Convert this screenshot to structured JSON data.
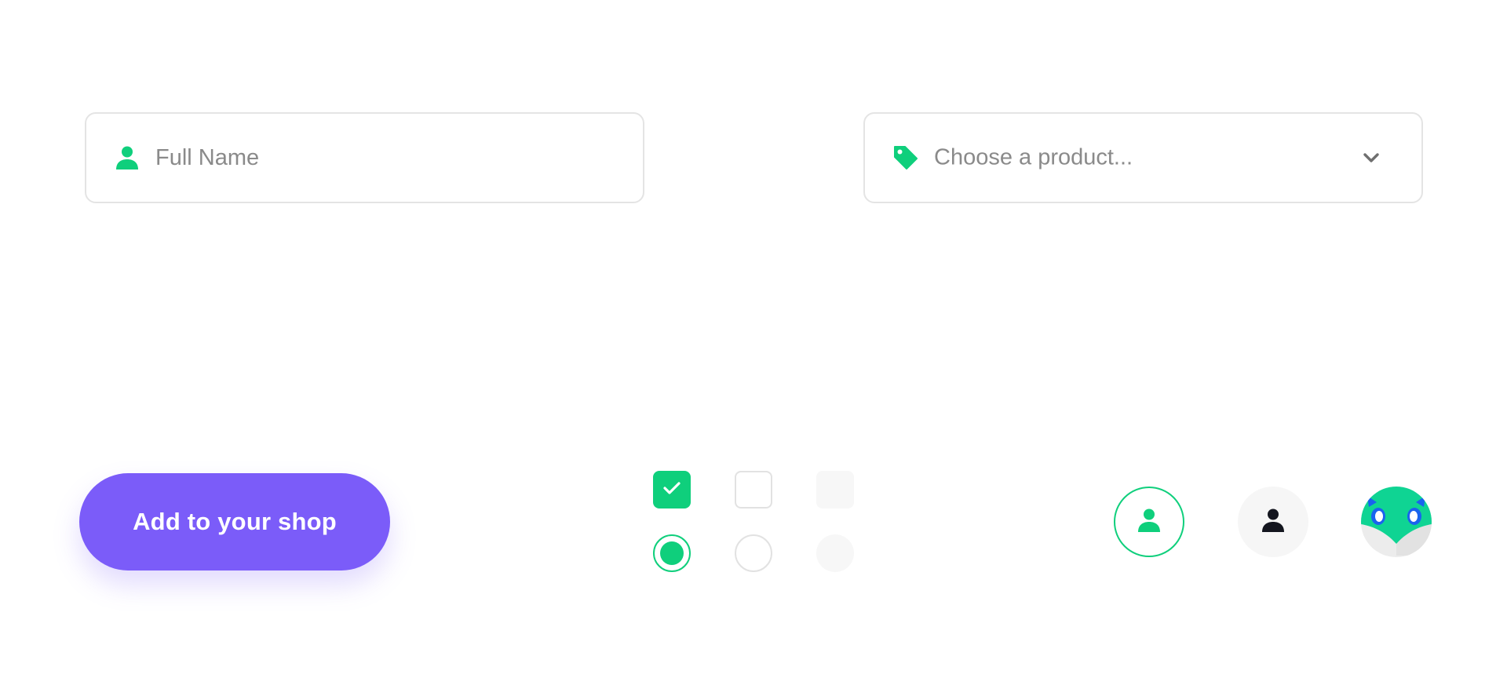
{
  "colors": {
    "accent_green": "#0fcf7c",
    "button_purple": "#7b5cf9",
    "border_gray": "#e4e4e4",
    "placeholder_gray": "#8a8a8a",
    "icon_dark": "#14161f",
    "mask_blue": "#1a63ee"
  },
  "name_input": {
    "placeholder": "Full Name",
    "value": "",
    "icon": "user-icon"
  },
  "product_select": {
    "placeholder": "Choose a product...",
    "icon": "tag-icon",
    "trailing_icon": "chevron-down-icon"
  },
  "primary_button": {
    "label": "Add to your shop"
  },
  "checkboxes": [
    {
      "state": "checked"
    },
    {
      "state": "unchecked"
    },
    {
      "state": "disabled"
    }
  ],
  "radios": [
    {
      "state": "selected"
    },
    {
      "state": "unselected"
    },
    {
      "state": "disabled"
    }
  ],
  "avatars": [
    {
      "style": "outlined",
      "icon": "user-icon"
    },
    {
      "style": "filled-gray",
      "icon": "user-icon"
    },
    {
      "style": "image",
      "icon": "mask-avatar-icon"
    }
  ]
}
